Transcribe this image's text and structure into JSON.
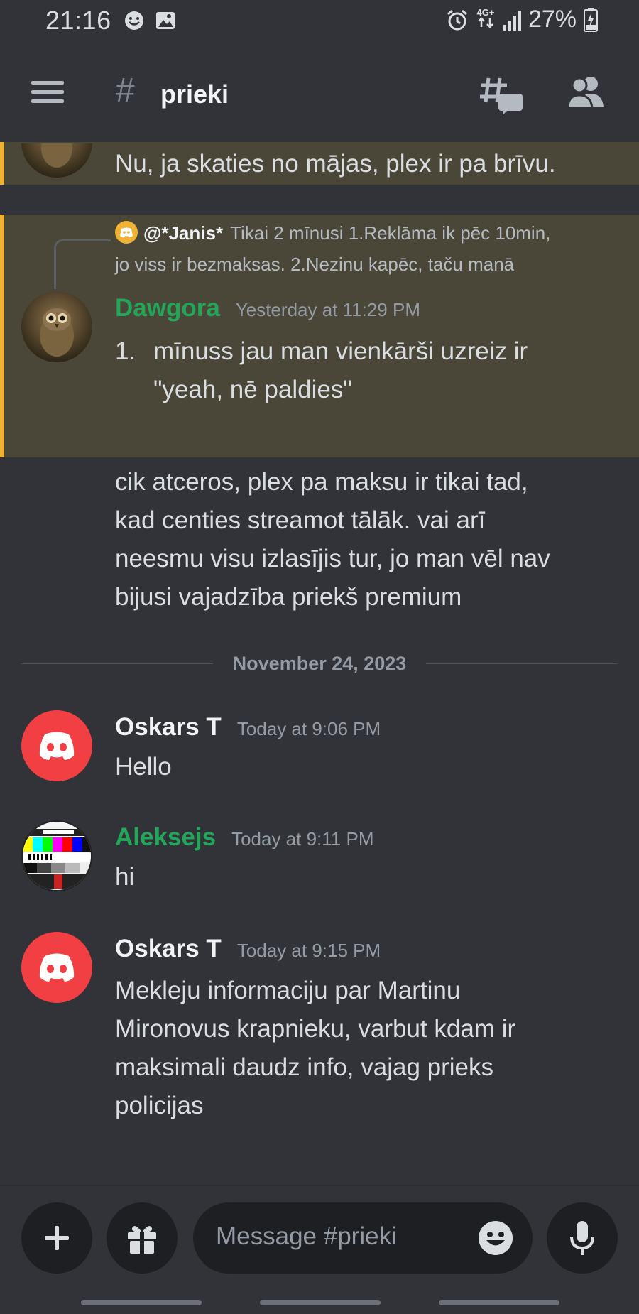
{
  "status_bar": {
    "time": "21:16",
    "network": "4G+",
    "battery": "27%"
  },
  "header": {
    "channel_symbol": "#",
    "channel_name": "prieki"
  },
  "messages": {
    "prev_fragment": "Nu, ja skaties no mājas, plex ir pa brīvu.",
    "reply": {
      "author": "@*Janis*",
      "line1": "Tikai 2 mīnusi  1.Reklāma ik pēc 10min,",
      "line2": "jo viss ir bezmaksas. 2.Nezinu kapēc, taču manā"
    },
    "dawgora": {
      "author": "Dawgora",
      "author_color": "#23a55a",
      "timestamp": "Yesterday at 11:29 PM",
      "list_number": "1.",
      "line1": "mīnuss jau man vienkārši uzreiz ir",
      "line2": "\"yeah, nē paldies\"",
      "cont1": "cik atceros, plex pa maksu ir tikai tad,",
      "cont2": "kad centies streamot tālāk. vai arī",
      "cont3": "neesmu visu izlasījis tur, jo man vēl nav",
      "cont4": "bijusi vajadzība priekš premium"
    },
    "date_divider": "November 24, 2023",
    "oskars1": {
      "author": "Oskars T",
      "timestamp": "Today at 9:06 PM",
      "text": "Hello"
    },
    "aleksejs": {
      "author": "Aleksejs",
      "author_color": "#23a55a",
      "timestamp": "Today at 9:11 PM",
      "text": "hi"
    },
    "oskars2": {
      "author": "Oskars T",
      "timestamp": "Today at 9:15 PM",
      "line1": "Mekleju informaciju par Martinu",
      "line2": "Mironovus krapnieku, varbut kdam ir",
      "line3": "maksimali daudz info, vajag prieks",
      "line4": "policijas"
    }
  },
  "composer": {
    "placeholder": "Message #prieki"
  },
  "icons": {
    "menu": "hamburger-menu-icon",
    "threads": "threads-icon",
    "members": "members-icon",
    "add": "plus-icon",
    "gift": "gift-icon",
    "emoji": "emoji-icon",
    "mic": "microphone-icon"
  },
  "colors": {
    "background": "#313338",
    "highlight": "#4a4738",
    "highlight_bar": "#f0b232",
    "discord_red": "#f23f43",
    "green_name": "#23a55a"
  }
}
